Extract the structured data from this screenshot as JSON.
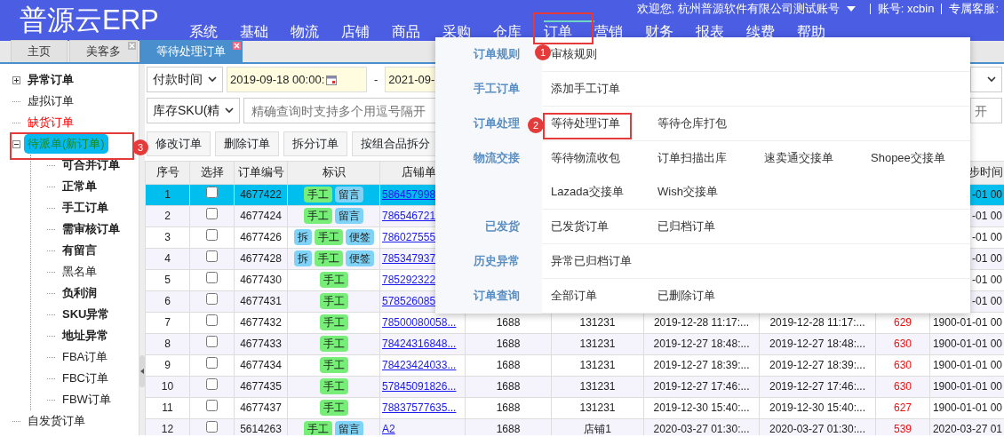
{
  "header": {
    "logo": "普源云ERP",
    "welcome": "欢迎您, 杭州普源软件有限公司测试账号",
    "account": "账号: xcbin",
    "service": "专属客服:",
    "nav": [
      {
        "label": "系统",
        "selected": false
      },
      {
        "label": "基础",
        "selected": false
      },
      {
        "label": "物流",
        "selected": false
      },
      {
        "label": "店铺",
        "selected": false
      },
      {
        "label": "商品",
        "selected": false
      },
      {
        "label": "采购",
        "selected": false
      },
      {
        "label": "仓库",
        "selected": false
      },
      {
        "label": "订单",
        "selected": true
      },
      {
        "label": "营销",
        "selected": false
      },
      {
        "label": "财务",
        "selected": false
      },
      {
        "label": "报表",
        "selected": false
      },
      {
        "label": "续费",
        "selected": false
      },
      {
        "label": "帮助",
        "selected": false
      }
    ]
  },
  "tabs": [
    {
      "label": "主页",
      "selected": false,
      "closable": false
    },
    {
      "label": "美客多",
      "selected": false,
      "closable": true
    },
    {
      "label": "等待处理订单",
      "selected": true,
      "closable": true
    }
  ],
  "sidebar": {
    "items": [
      {
        "label": "异常订单",
        "bold": true,
        "expanded": false,
        "selected": false
      },
      {
        "label": "虚拟订单",
        "bold": false,
        "selected": false
      },
      {
        "label": "缺货订单",
        "bold": false,
        "selected": false,
        "color": "#ff0000"
      },
      {
        "label": "待派单(新订单)",
        "bold": false,
        "expanded": true,
        "selected": true,
        "children": [
          {
            "label": "可合并订单",
            "bold": true,
            "selected": false
          },
          {
            "label": "正常单",
            "bold": true,
            "selected": false
          },
          {
            "label": "手工订单",
            "bold": true,
            "selected": false
          },
          {
            "label": "需审核订单",
            "bold": true,
            "selected": false
          },
          {
            "label": "有留言",
            "bold": true,
            "selected": false
          },
          {
            "label": "黑名单",
            "bold": false,
            "selected": false
          },
          {
            "label": "负利润",
            "bold": true,
            "selected": false
          },
          {
            "label": "SKU异常",
            "bold": true,
            "selected": false
          },
          {
            "label": "地址异常",
            "bold": true,
            "selected": false
          },
          {
            "label": "FBA订单",
            "bold": false,
            "selected": false
          },
          {
            "label": "FBC订单",
            "bold": false,
            "selected": false
          },
          {
            "label": "FBW订单",
            "bold": false,
            "selected": false
          }
        ]
      },
      {
        "label": "自发货订单",
        "bold": false,
        "selected": false
      }
    ]
  },
  "filters": {
    "time_type": "付款时间",
    "date_from": "2019-09-18 00:00:",
    "separator": "-",
    "date_to": "2021-09-",
    "sku_type": "库存SKU(精",
    "search": {
      "placeholder": "精确查询时支持多个用逗号隔开"
    },
    "right_field": {
      "placeholder": "开"
    }
  },
  "actions": [
    "修改订单",
    "删除订单",
    "拆分订单",
    "按组合品拆分"
  ],
  "table": {
    "header": {
      "no": "序号",
      "select": "选择",
      "order_id": "订单编号",
      "tags": "标识",
      "shop_order": "店铺单",
      "sync_time": "步时间"
    },
    "rows": [
      {
        "no": "1",
        "selected": true,
        "checked": false,
        "order_id": "4677422",
        "tags": [
          {
            "label": "手工",
            "color": "#77ee77"
          },
          {
            "label": "留言",
            "color": "#7fd3f7"
          }
        ],
        "shop_order": "586457998",
        "sync_time": "-01 00"
      },
      {
        "no": "2",
        "selected": false,
        "checked": false,
        "order_id": "4677424",
        "tags": [
          {
            "label": "手工",
            "color": "#77ee77"
          },
          {
            "label": "留言",
            "color": "#7fd3f7"
          }
        ],
        "shop_order": "786546721",
        "sync_time": "-01 00"
      },
      {
        "no": "3",
        "selected": false,
        "checked": false,
        "order_id": "4677426",
        "tags": [
          {
            "label": "拆",
            "color": "#7fd3f7"
          },
          {
            "label": "手工",
            "color": "#77ee77"
          },
          {
            "label": "便签",
            "color": "#7fd3f7"
          }
        ],
        "shop_order": "786027555",
        "sync_time": "-01 00"
      },
      {
        "no": "4",
        "selected": false,
        "checked": false,
        "order_id": "4677428",
        "tags": [
          {
            "label": "拆",
            "color": "#7fd3f7"
          },
          {
            "label": "手工",
            "color": "#77ee77"
          },
          {
            "label": "便签",
            "color": "#7fd3f7"
          }
        ],
        "shop_order": "785347937",
        "sync_time": "-01 00"
      },
      {
        "no": "5",
        "selected": false,
        "checked": false,
        "order_id": "4677430",
        "tags": [
          {
            "label": "手工",
            "color": "#77ee77"
          }
        ],
        "shop_order": "785292322",
        "sync_time": "-01 00"
      },
      {
        "no": "6",
        "selected": false,
        "checked": false,
        "order_id": "4677431",
        "tags": [
          {
            "label": "手工",
            "color": "#77ee77"
          }
        ],
        "shop_order": "578526085",
        "sync_time": "-01 00"
      },
      {
        "no": "7",
        "selected": false,
        "checked": false,
        "order_id": "4677432",
        "tags": [
          {
            "label": "手工",
            "color": "#77ee77"
          }
        ],
        "shop_order": "78500080058...",
        "platform": "1688",
        "store": "131231",
        "time_1": "2019-12-28 11:17:...",
        "time_2": "2019-12-28 11:17:...",
        "days": "629",
        "sync_time": "1900-01-01 00"
      },
      {
        "no": "8",
        "selected": false,
        "checked": false,
        "order_id": "4677433",
        "tags": [
          {
            "label": "手工",
            "color": "#77ee77"
          }
        ],
        "shop_order": "78424316848...",
        "platform": "1688",
        "store": "131231",
        "time_1": "2019-12-27 18:48:...",
        "time_2": "2019-12-27 18:48:...",
        "days": "630",
        "sync_time": "1900-01-01 00"
      },
      {
        "no": "9",
        "selected": false,
        "checked": false,
        "order_id": "4677434",
        "tags": [
          {
            "label": "手工",
            "color": "#77ee77"
          }
        ],
        "shop_order": "78423424033...",
        "platform": "1688",
        "store": "131231",
        "time_1": "2019-12-27 18:39:...",
        "time_2": "2019-12-27 18:39:...",
        "days": "630",
        "sync_time": "1900-01-01 00"
      },
      {
        "no": "10",
        "selected": false,
        "checked": false,
        "order_id": "4677435",
        "tags": [
          {
            "label": "手工",
            "color": "#77ee77"
          }
        ],
        "shop_order": "57845091826...",
        "platform": "1688",
        "store": "131231",
        "time_1": "2019-12-27 17:46:...",
        "time_2": "2019-12-27 17:46:...",
        "days": "630",
        "sync_time": "1900-01-01 00"
      },
      {
        "no": "11",
        "selected": false,
        "checked": false,
        "order_id": "4677437",
        "tags": [
          {
            "label": "手工",
            "color": "#77ee77"
          }
        ],
        "shop_order": "78837577635...",
        "platform": "1688",
        "store": "131231",
        "time_1": "2019-12-30 15:40:...",
        "time_2": "2019-12-30 15:40:...",
        "days": "627",
        "sync_time": "1900-01-01 00"
      },
      {
        "no": "12",
        "selected": false,
        "checked": false,
        "order_id": "5614263",
        "tags": [
          {
            "label": "手工",
            "color": "#77ee77"
          },
          {
            "label": "留言",
            "color": "#7fd3f7"
          }
        ],
        "shop_order": "A2",
        "platform": "1688",
        "store": "店铺1",
        "time_1": "2020-03-27 01:30:...",
        "time_2": "2020-03-27 01:30:...",
        "days": "539",
        "sync_time": "2020-03-27 01"
      }
    ]
  },
  "menu": {
    "sections": [
      {
        "label": "订单规则",
        "links": [
          "审核规则"
        ]
      },
      {
        "label": "手工订单",
        "links": [
          "添加手工订单"
        ]
      },
      {
        "label": "订单处理",
        "links": [
          "等待处理订单",
          "等待仓库打包"
        ]
      },
      {
        "label": "物流交接",
        "links": [
          "等待物流收包",
          "订单扫描出库",
          "速卖通交接单",
          "Shopee交接单",
          "Lazada交接单",
          "Wish交接单"
        ]
      },
      {
        "label": "已发货",
        "links": [
          "已发货订单",
          "已归档订单"
        ]
      },
      {
        "label": "历史异常",
        "links": [
          "异常已归档订单"
        ]
      },
      {
        "label": "订单查询",
        "links": [
          "全部订单",
          "已删除订单"
        ]
      }
    ]
  },
  "annotations": [
    {
      "label": "1"
    },
    {
      "label": "2"
    },
    {
      "label": "3"
    }
  ]
}
